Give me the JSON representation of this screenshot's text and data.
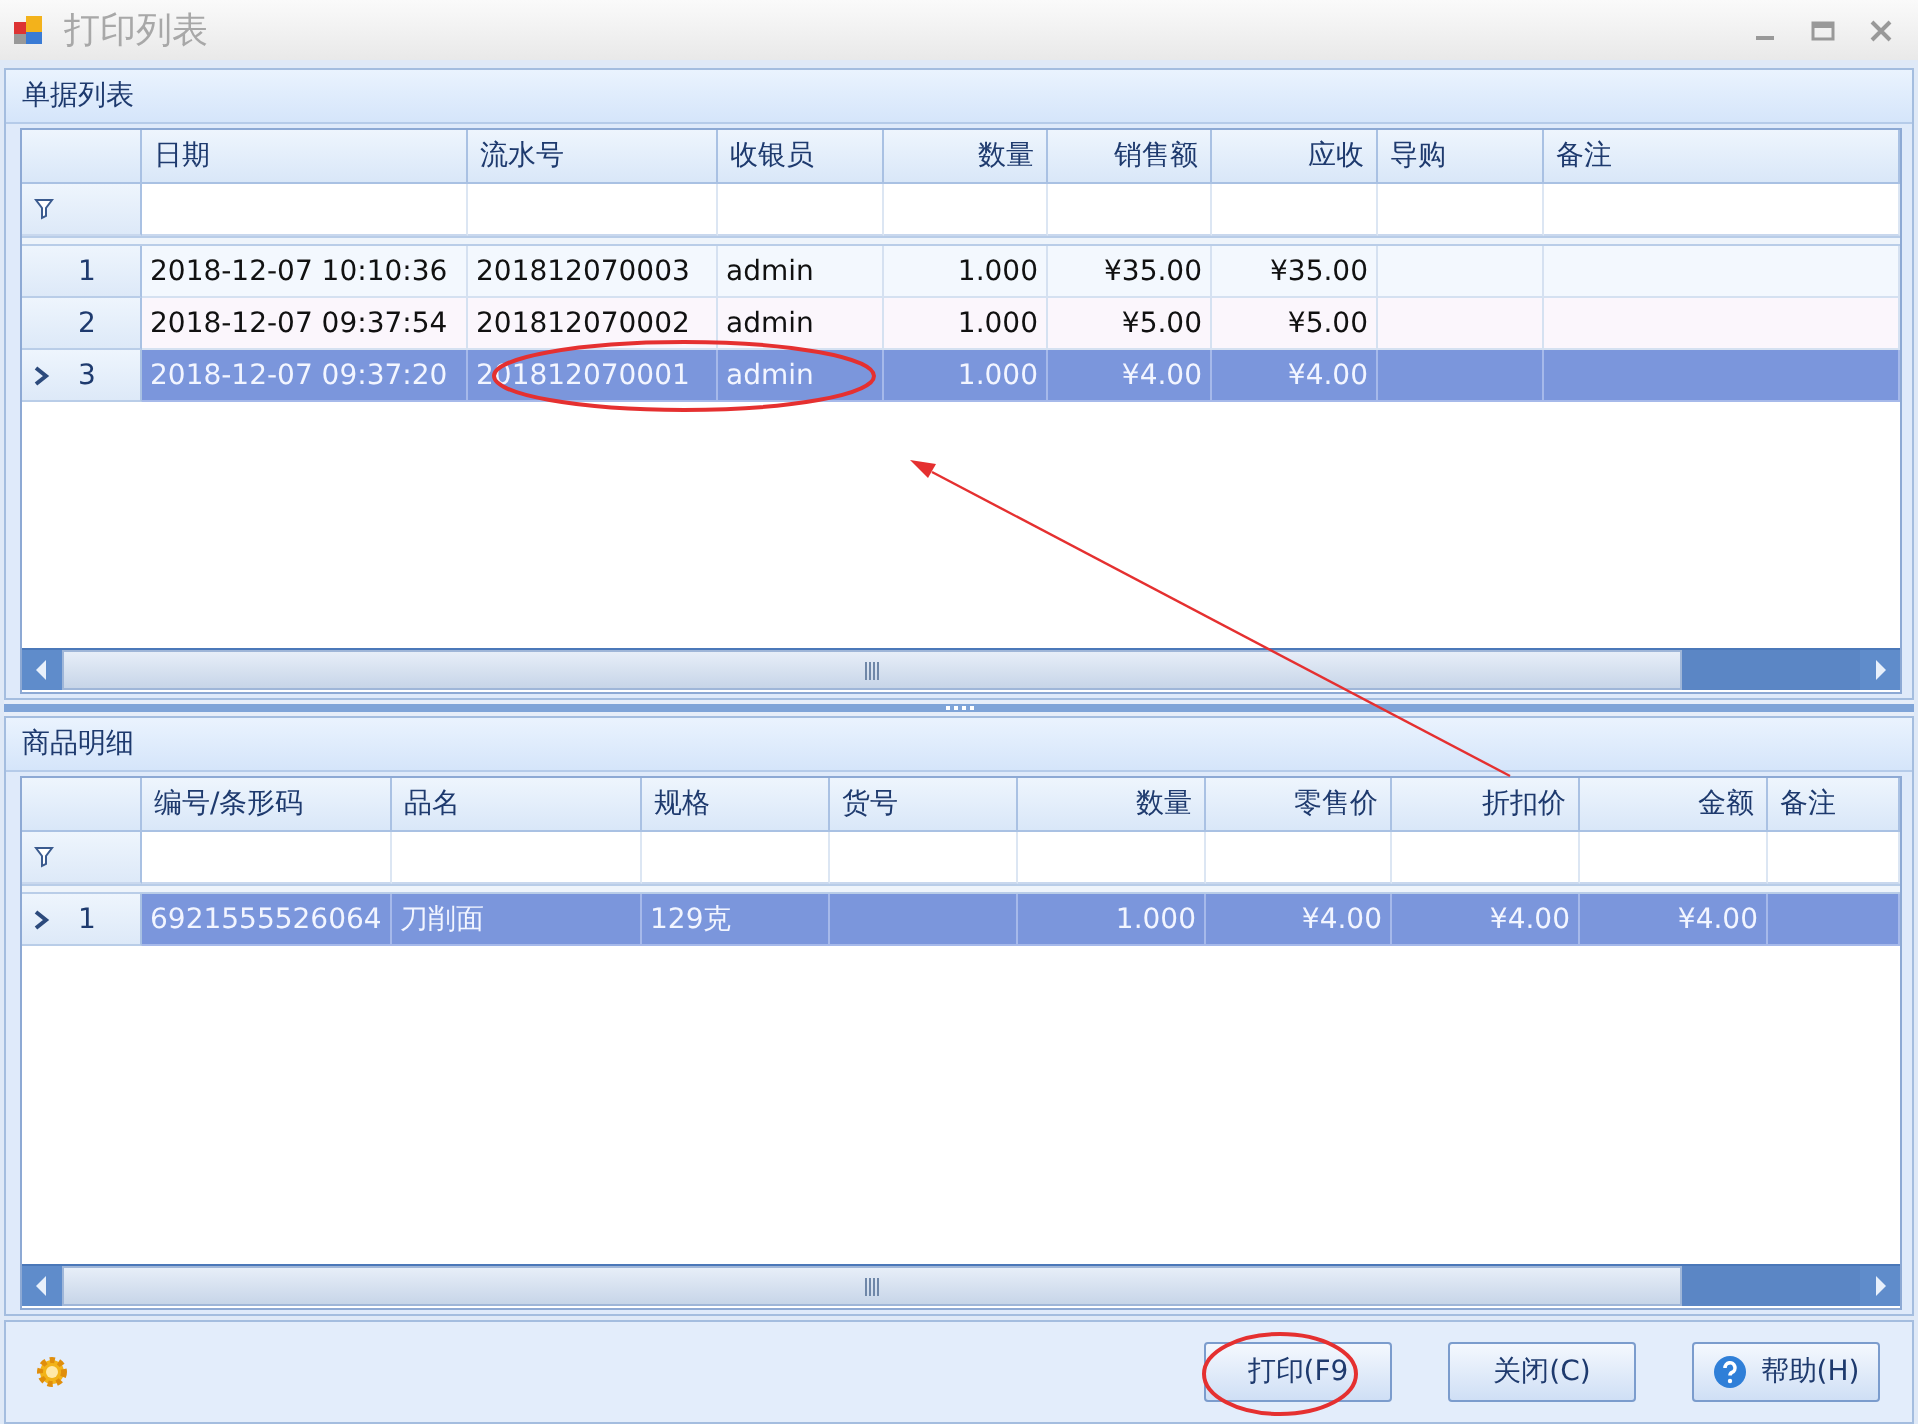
{
  "window": {
    "title": "打印列表",
    "controls": [
      {
        "kind": "minimize"
      },
      {
        "kind": "maximize"
      },
      {
        "kind": "close"
      }
    ]
  },
  "panels": [
    {
      "title": "单据列表",
      "table": {
        "columns": [
          "日期",
          "流水号",
          "收银员",
          "数量",
          "销售额",
          "应收",
          "导购",
          "备注"
        ],
        "rows": [
          {
            "number": "1",
            "selected": false,
            "cells": [
              "2018-12-07 10:10:36",
              "201812070003",
              "admin",
              "1.000",
              "¥35.00",
              "¥35.00",
              "",
              ""
            ]
          },
          {
            "number": "2",
            "selected": false,
            "cells": [
              "2018-12-07 09:37:54",
              "201812070002",
              "admin",
              "1.000",
              "¥5.00",
              "¥5.00",
              "",
              ""
            ]
          },
          {
            "number": "3",
            "selected": true,
            "cells": [
              "2018-12-07 09:37:20",
              "201812070001",
              "admin",
              "1.000",
              "¥4.00",
              "¥4.00",
              "",
              ""
            ]
          }
        ]
      }
    },
    {
      "title": "商品明细",
      "table": {
        "columns": [
          "编号/条形码",
          "品名",
          "规格",
          "货号",
          "数量",
          "零售价",
          "折扣价",
          "金额",
          "备注"
        ],
        "rows": [
          {
            "number": "1",
            "selected": true,
            "cells": [
              "6921555526064",
              "刀削面",
              "129克",
              "",
              "1.000",
              "¥4.00",
              "¥4.00",
              "¥4.00",
              ""
            ]
          }
        ]
      }
    }
  ],
  "buttons": [
    {
      "label": "打印(F9",
      "kind": "plain"
    },
    {
      "label": "关闭(C)",
      "kind": "plain"
    },
    {
      "label": "帮助(H)",
      "kind": "help"
    }
  ],
  "annotations": [
    {
      "kind": "ellipse"
    },
    {
      "kind": "arrow"
    },
    {
      "kind": "ellipse"
    }
  ]
}
